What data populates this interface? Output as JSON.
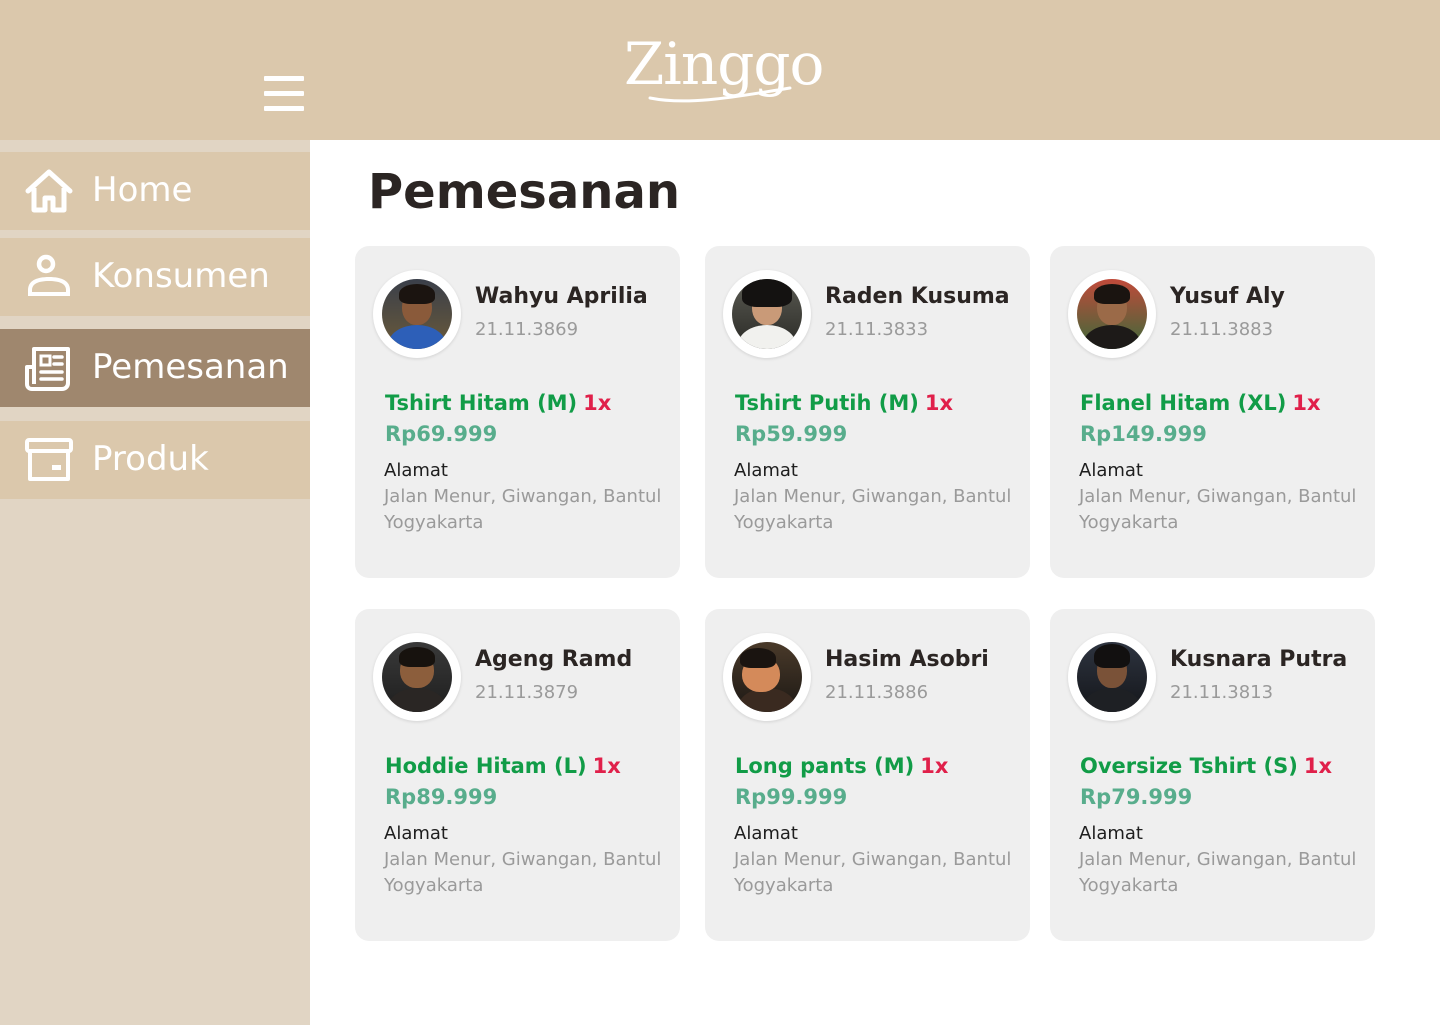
{
  "brand": {
    "name": "Zinggo"
  },
  "colors": {
    "header_bg": "#dbc8ac",
    "sidebar_bg": "#e1d5c4",
    "nav_item_bg": "#dbc8ac",
    "nav_item_active_bg": "#9f876e",
    "card_bg": "#efefef",
    "product_green": "#119c47",
    "qty_red": "#e0204a",
    "price_green": "#58ad8c"
  },
  "header": {
    "menu_icon": "hamburger-icon"
  },
  "sidebar": {
    "items": [
      {
        "label": "Home",
        "icon": "home-icon",
        "active": false
      },
      {
        "label": "Konsumen",
        "icon": "user-icon",
        "active": false
      },
      {
        "label": "Pemesanan",
        "icon": "newspaper-icon",
        "active": true
      },
      {
        "label": "Produk",
        "icon": "archive-box-icon",
        "active": false
      }
    ]
  },
  "main": {
    "title": "Pemesanan",
    "orders": [
      {
        "name": "Wahyu Aprilia",
        "id": "21.11.3869",
        "product": "Tshirt Hitam (M)",
        "qty": "1x",
        "price": "Rp69.999",
        "address_label": "Alamat",
        "address_line1": "Jalan Menur, Giwangan, Bantul",
        "address_line2": "Yogyakarta"
      },
      {
        "name": "Raden Kusuma",
        "id": "21.11.3833",
        "product": "Tshirt Putih (M)",
        "qty": "1x",
        "price": "Rp59.999",
        "address_label": "Alamat",
        "address_line1": "Jalan Menur, Giwangan, Bantul",
        "address_line2": "Yogyakarta"
      },
      {
        "name": "Yusuf Aly",
        "id": "21.11.3883",
        "product": "Flanel Hitam (XL)",
        "qty": "1x",
        "price": "Rp149.999",
        "address_label": "Alamat",
        "address_line1": "Jalan Menur, Giwangan, Bantul",
        "address_line2": "Yogyakarta"
      },
      {
        "name": "Ageng Ramd",
        "id": "21.11.3879",
        "product": "Hoddie Hitam (L)",
        "qty": "1x",
        "price": "Rp89.999",
        "address_label": "Alamat",
        "address_line1": "Jalan Menur, Giwangan, Bantul",
        "address_line2": "Yogyakarta"
      },
      {
        "name": "Hasim Asobri",
        "id": "21.11.3886",
        "product": "Long pants (M)",
        "qty": "1x",
        "price": "Rp99.999",
        "address_label": "Alamat",
        "address_line1": "Jalan Menur, Giwangan, Bantul",
        "address_line2": "Yogyakarta"
      },
      {
        "name": "Kusnara Putra",
        "id": "21.11.3813",
        "product": "Oversize Tshirt (S)",
        "qty": "1x",
        "price": "Rp79.999",
        "address_label": "Alamat",
        "address_line1": "Jalan Menur, Giwangan, Bantul",
        "address_line2": "Yogyakarta"
      }
    ]
  }
}
